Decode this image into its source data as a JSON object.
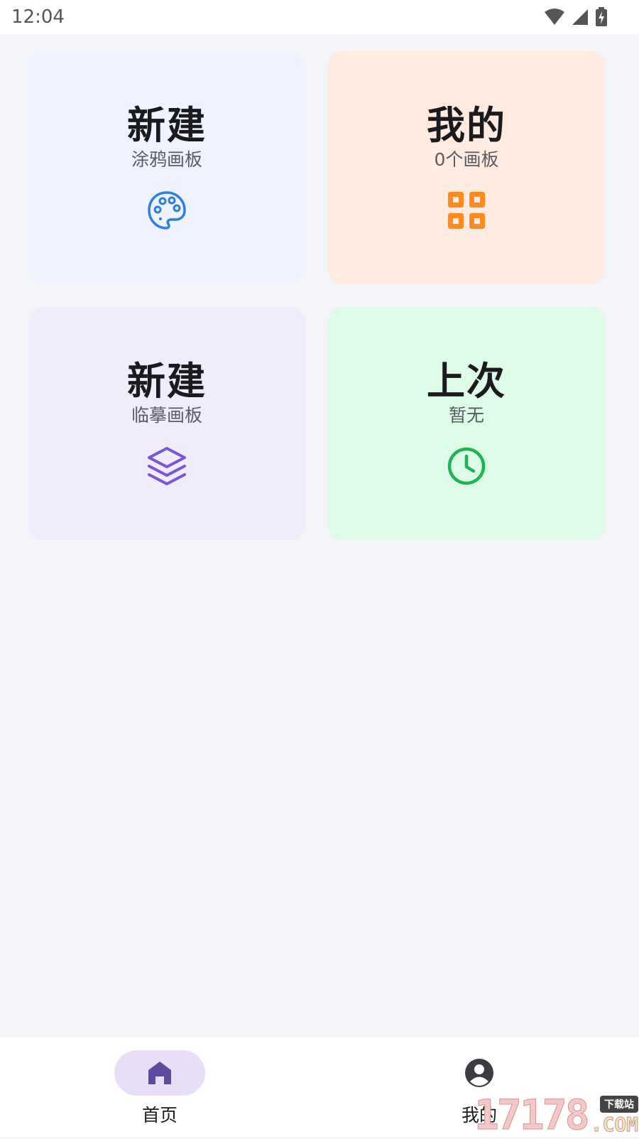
{
  "status_bar": {
    "time": "12:04"
  },
  "cards": [
    {
      "title": "新建",
      "subtitle": "涂鸦画板",
      "icon": "palette-icon",
      "accent": "#2f7ee0",
      "bg": "#eef3ff"
    },
    {
      "title": "我的",
      "subtitle": "0个画板",
      "icon": "grid-icon",
      "accent": "#ff8a1e",
      "bg": "#ffebe0"
    },
    {
      "title": "新建",
      "subtitle": "临摹画板",
      "icon": "layers-icon",
      "accent": "#7a55d6",
      "bg": "#f1ecfc"
    },
    {
      "title": "上次",
      "subtitle": "暂无",
      "icon": "clock-icon",
      "accent": "#1fb356",
      "bg": "#dcfce8"
    }
  ],
  "bottom_nav": {
    "items": [
      {
        "label": "首页",
        "icon": "home-icon",
        "active": true
      },
      {
        "label": "我的",
        "icon": "account-icon",
        "active": false
      }
    ],
    "active_color": "#5e4b9e"
  },
  "watermark": {
    "number": "17178",
    "tag": "下载站",
    "suffix": ".COM"
  }
}
